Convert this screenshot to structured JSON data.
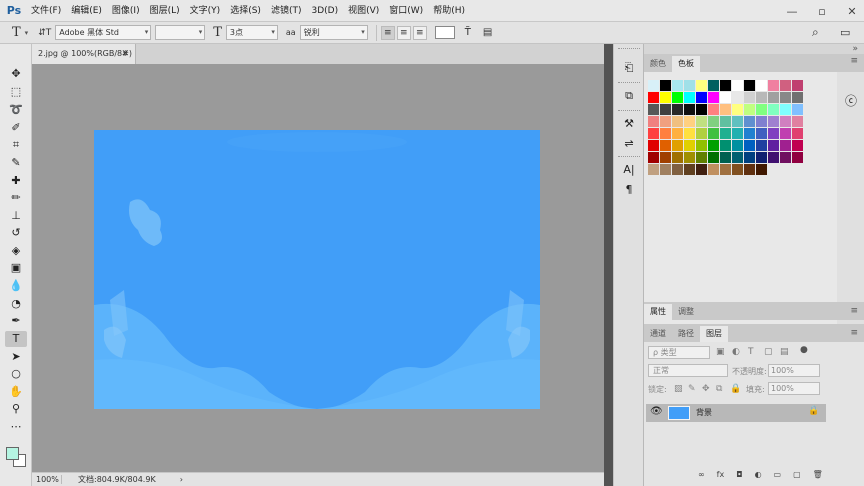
{
  "app": {
    "logo": "Ps"
  },
  "menu": [
    "文件(F)",
    "编辑(E)",
    "图像(I)",
    "图层(L)",
    "文字(Y)",
    "选择(S)",
    "滤镜(T)",
    "3D(D)",
    "视图(V)",
    "窗口(W)",
    "帮助(H)"
  ],
  "window_controls": {
    "minimize": "—",
    "restore": "▫",
    "close": "✕"
  },
  "options_bar": {
    "tool_glyph": "T",
    "orient_glyph": "⇵T",
    "font_family": "Adobe 黑体 Std",
    "font_style": "",
    "size_glyph": "T",
    "font_size": "3点",
    "aa_glyph": "aa",
    "antialias": "锐利",
    "warp_glyph": "T̃",
    "panel_glyph": "▤",
    "search_glyph": "⌕",
    "workspace_glyph": "▭"
  },
  "document": {
    "tab_title": "2.jpg @ 100%(RGB/8#)",
    "tab_close": "✕",
    "zoom": "100%",
    "doc_size": "文档:804.9K/804.9K",
    "artboard_color": "#419ef8"
  },
  "tools": [
    {
      "name": "move-tool",
      "glyph": "✥"
    },
    {
      "name": "marquee-tool",
      "glyph": "⬚"
    },
    {
      "name": "lasso-tool",
      "glyph": "➰"
    },
    {
      "name": "quick-select-tool",
      "glyph": "✐"
    },
    {
      "name": "crop-tool",
      "glyph": "⌗"
    },
    {
      "name": "eyedropper-tool",
      "glyph": "✎"
    },
    {
      "name": "healing-tool",
      "glyph": "✚"
    },
    {
      "name": "brush-tool",
      "glyph": "✏"
    },
    {
      "name": "clone-stamp-tool",
      "glyph": "⊥"
    },
    {
      "name": "history-brush-tool",
      "glyph": "↺"
    },
    {
      "name": "eraser-tool",
      "glyph": "◈"
    },
    {
      "name": "gradient-tool",
      "glyph": "▣"
    },
    {
      "name": "blur-tool",
      "glyph": "💧"
    },
    {
      "name": "dodge-tool",
      "glyph": "◔"
    },
    {
      "name": "pen-tool",
      "glyph": "✒"
    },
    {
      "name": "type-tool",
      "glyph": "T"
    },
    {
      "name": "path-select-tool",
      "glyph": "➤"
    },
    {
      "name": "shape-tool",
      "glyph": "○"
    },
    {
      "name": "hand-tool",
      "glyph": "✋"
    },
    {
      "name": "zoom-tool",
      "glyph": "⚲"
    },
    {
      "name": "more-tools",
      "glyph": "⋯"
    }
  ],
  "panels": {
    "swatch_tabs": [
      "颜色",
      "色板"
    ],
    "properties_tabs": [
      "属性",
      "调整"
    ],
    "layer_tabs": [
      "通道",
      "路径",
      "图层"
    ],
    "layer_filter": "ρ 类型",
    "blend_mode": "正常",
    "opacity_label": "不透明度:",
    "opacity_value": "100%",
    "lock_label": "锁定:",
    "fill_label": "填充:",
    "fill_value": "100%",
    "layer_name": "背景",
    "bottom_icons": [
      "∞",
      "fx",
      "◘",
      "◐",
      "▭",
      "▢",
      "🗑"
    ]
  },
  "swatches": [
    [
      "#d8f0f8",
      "#000000",
      "#a8e8f0",
      "#a0e0e8",
      "#ffff80",
      "#006060",
      "#000000",
      "#ffffff",
      "#000000",
      "#ffffff",
      "#f080a0",
      "#d06080",
      "#c04070"
    ],
    [
      "#ff0000",
      "#ffff00",
      "#00ff00",
      "#00ffff",
      "#0000ff",
      "#ff00ff",
      "#ffffff",
      "#e8e8e8",
      "#d0d0d0",
      "#b8b8b8",
      "#a0a0a0",
      "#888888",
      "#707070"
    ],
    [
      "#585858",
      "#404040",
      "#282828",
      "#101010",
      "#000000",
      "#ff8080",
      "#ffc080",
      "#ffff80",
      "#c0ff80",
      "#80ff80",
      "#80ffc0",
      "#80ffff",
      "#80c0ff"
    ],
    [
      "#f08080",
      "#f0a080",
      "#f0c080",
      "#ffd080",
      "#c0e080",
      "#80d080",
      "#60c0a0",
      "#60c0c0",
      "#6090d0",
      "#8080d0",
      "#a080d0",
      "#d080c0",
      "#e080a0"
    ],
    [
      "#ff4040",
      "#ff8040",
      "#ffb040",
      "#ffe040",
      "#b0d040",
      "#40c040",
      "#20b090",
      "#20b0b0",
      "#2080d0",
      "#4060c0",
      "#8040c0",
      "#c040b0",
      "#e04070"
    ],
    [
      "#e00000",
      "#e06000",
      "#e0a000",
      "#e0d000",
      "#90c000",
      "#00a000",
      "#009070",
      "#0090a0",
      "#0060c0",
      "#2040a0",
      "#6020a0",
      "#a02090",
      "#c00050"
    ],
    [
      "#a00000",
      "#a04000",
      "#a07000",
      "#a09000",
      "#608000",
      "#007000",
      "#006050",
      "#006070",
      "#004080",
      "#102070",
      "#401070",
      "#701060",
      "#900040"
    ],
    [
      "#c0a080",
      "#a08060",
      "#806040",
      "#604020",
      "#402010",
      "#c09060",
      "#a07040",
      "#805020",
      "#603010",
      "#401800"
    ]
  ]
}
